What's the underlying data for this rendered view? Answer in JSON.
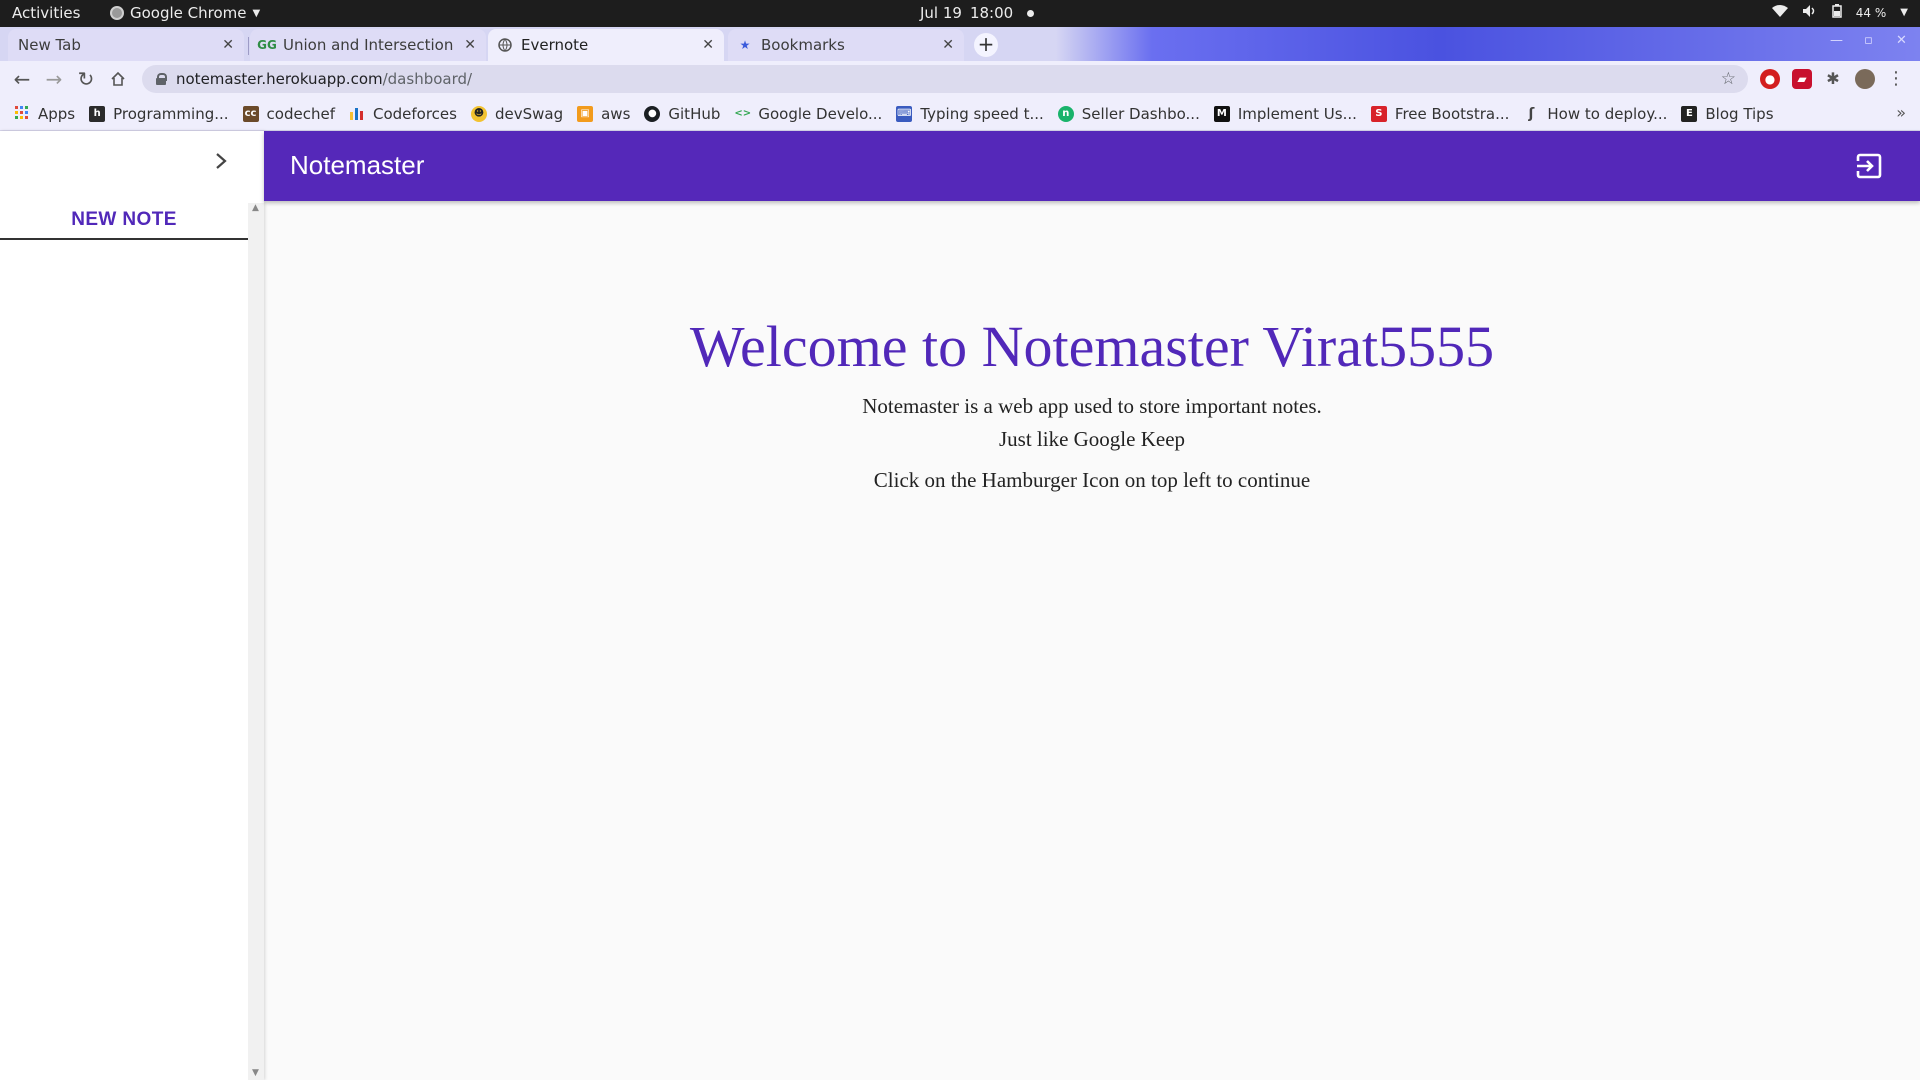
{
  "os_bar": {
    "activities": "Activities",
    "app_name": "Google Chrome",
    "date": "Jul 19",
    "time": "18:00",
    "battery": "44 %"
  },
  "tabs": [
    {
      "title": "New Tab",
      "favicon": "",
      "active": false
    },
    {
      "title": "Union and Intersection of",
      "favicon": "gfg-icon",
      "active": false
    },
    {
      "title": "Evernote",
      "favicon": "globe-icon",
      "active": true
    },
    {
      "title": "Bookmarks",
      "favicon": "star-icon",
      "active": false
    }
  ],
  "address_bar": {
    "host": "notemaster.herokuapp.com",
    "path": "/dashboard/"
  },
  "bookmarks": [
    {
      "label": "Apps",
      "icon": "apps-grid-icon",
      "color": "#e04a3b"
    },
    {
      "label": "Programming...",
      "icon": "hackerrank-icon",
      "color": "#2b2b2b"
    },
    {
      "label": "codechef",
      "icon": "codechef-icon",
      "color": "#6b4a2a"
    },
    {
      "label": "Codeforces",
      "icon": "codeforces-icon",
      "color": "#1a73c7"
    },
    {
      "label": "devSwag",
      "icon": "emoji-icon",
      "color": "#f2c230"
    },
    {
      "label": "aws",
      "icon": "aws-icon",
      "color": "#f29b1d"
    },
    {
      "label": "GitHub",
      "icon": "github-icon",
      "color": "#1b1f23"
    },
    {
      "label": "Google Develo...",
      "icon": "google-dev-icon",
      "color": "#34a853"
    },
    {
      "label": "Typing speed t...",
      "icon": "keyboard-icon",
      "color": "#3a5bbf"
    },
    {
      "label": "Seller Dashbo...",
      "icon": "seller-icon",
      "color": "#19b36b"
    },
    {
      "label": "Implement Us...",
      "icon": "medium-icon",
      "color": "#111111"
    },
    {
      "label": "Free Bootstra...",
      "icon": "bootstrap-icon",
      "color": "#d8222a"
    },
    {
      "label": "How to deploy...",
      "icon": "link-icon",
      "color": "#444444"
    },
    {
      "label": "Blog Tips",
      "icon": "blog-icon",
      "color": "#222222"
    }
  ],
  "sidebar": {
    "new_note": "NEW NOTE"
  },
  "appbar": {
    "brand": "Notemaster"
  },
  "welcome": {
    "heading": "Welcome to Notemaster Virat5555",
    "line1": "Notemaster is a web app used to store important notes.",
    "line2": "Just like Google Keep",
    "line3": "Click on the Hamburger Icon on top left to continue"
  },
  "colors": {
    "brand_purple": "#5528b9",
    "heading_purple": "#5128b9"
  }
}
